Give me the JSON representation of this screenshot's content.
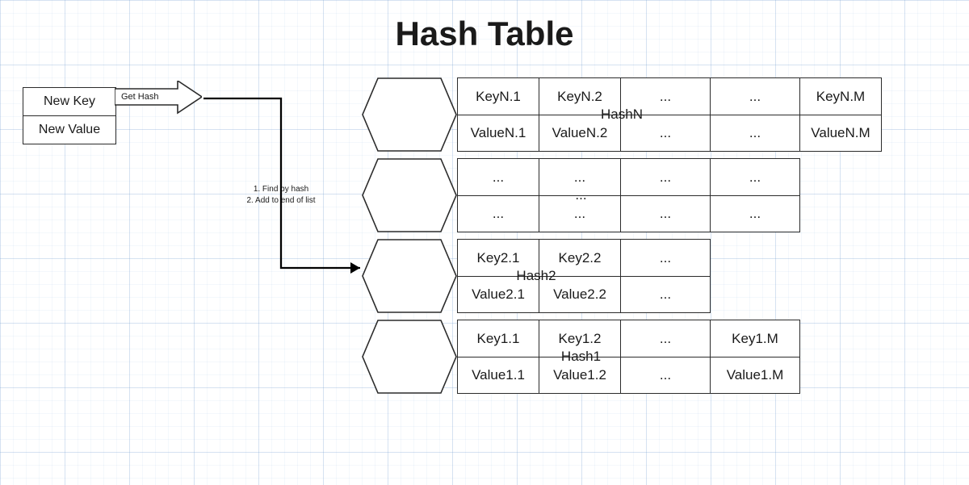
{
  "title": "Hash Table",
  "input": {
    "key": "New Key",
    "value": "New Value",
    "action": "Get Hash"
  },
  "steps": [
    "1. Find by hash",
    "2. Add to end of list"
  ],
  "ellipsis": "...",
  "rows": [
    {
      "hash": "HashN",
      "cols": [
        {
          "k": "KeyN.1",
          "v": "ValueN.1"
        },
        {
          "k": "KeyN.2",
          "v": "ValueN.2"
        },
        {
          "k": "...",
          "v": "..."
        },
        {
          "k": "...",
          "v": "..."
        },
        {
          "k": "KeyN.M",
          "v": "ValueN.M"
        }
      ]
    },
    {
      "hash": "...",
      "cols": [
        {
          "k": "...",
          "v": "..."
        },
        {
          "k": "...",
          "v": "..."
        },
        {
          "k": "...",
          "v": "..."
        },
        {
          "k": "...",
          "v": "..."
        }
      ]
    },
    {
      "hash": "Hash2",
      "cols": [
        {
          "k": "Key2.1",
          "v": "Value2.1"
        },
        {
          "k": "Key2.2",
          "v": "Value2.2"
        },
        {
          "k": "...",
          "v": "..."
        }
      ]
    },
    {
      "hash": "Hash1",
      "cols": [
        {
          "k": "Key1.1",
          "v": "Value1.1"
        },
        {
          "k": "Key1.2",
          "v": "Value1.2"
        },
        {
          "k": "...",
          "v": "..."
        },
        {
          "k": "Key1.M",
          "v": "Value1.M"
        }
      ]
    }
  ]
}
